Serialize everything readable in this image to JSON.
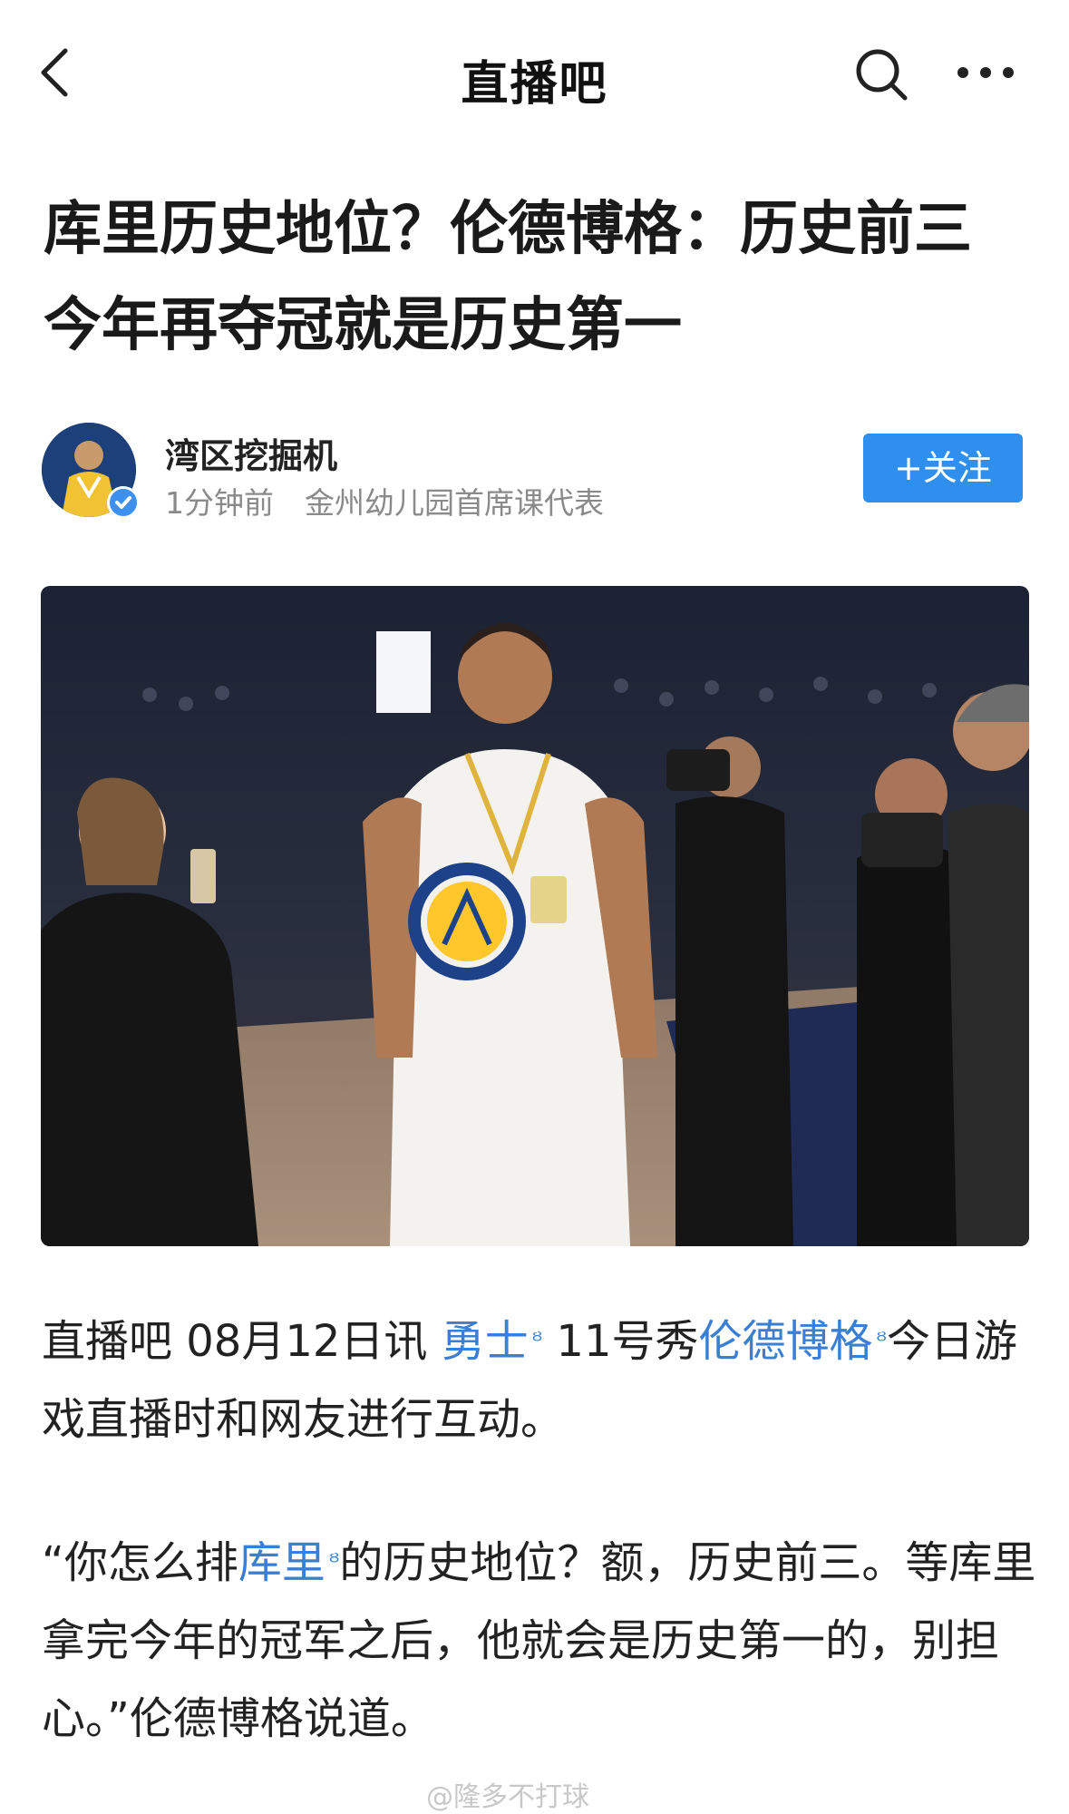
{
  "nav": {
    "title": "直播吧",
    "back_icon": "chevron-left-icon",
    "search_icon": "search-icon",
    "more_icon": "more-dots-icon"
  },
  "article": {
    "title": "库里历史地位？伦德博格：历史前三 今年再夺冠就是历史第一",
    "author": {
      "name": "湾区挖掘机",
      "time": "1分钟前",
      "bio": "金州幼儿园首席课代表",
      "follow_label": "+关注"
    },
    "paragraph1": {
      "prefix": "直播吧 08月12日讯 ",
      "link1": "勇士",
      "middle": " 11号秀",
      "link2": "伦德博格",
      "suffix": "今日游戏直播时和网友进行互动。"
    },
    "paragraph2": {
      "prefix": "“你怎么排",
      "link": "库里",
      "suffix": "的历史地位？额，历史前三。等库里拿完今年的冠军之后，他就会是历史第一的，别担心。”伦德博格说道。"
    }
  },
  "watermark": "@隆多不打球",
  "colors": {
    "accent": "#2f8fee",
    "link": "#3a7fd4",
    "meta": "#8a8a8a"
  }
}
